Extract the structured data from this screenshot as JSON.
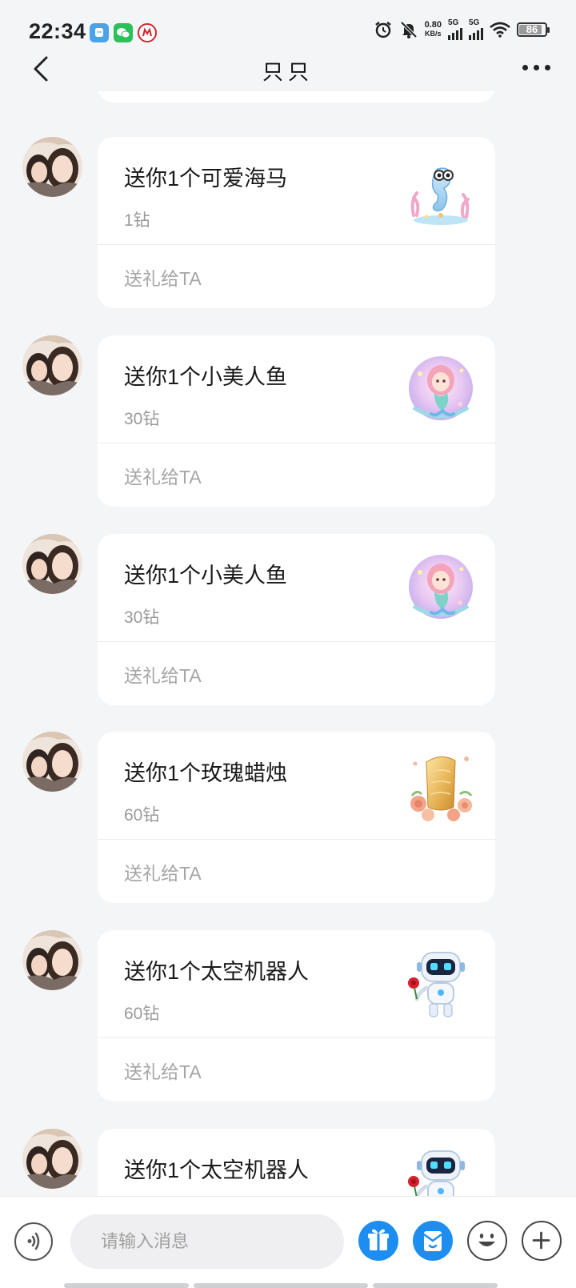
{
  "status_bar": {
    "time": "22:34",
    "net_speed_value": "0.80",
    "net_speed_unit": "KB/s",
    "sim1_label": "5G",
    "sim2_label": "5G",
    "battery": "86",
    "battery_level": 0.86,
    "app_icons": [
      "app-notification-icon",
      "wechat-icon",
      "red-app-icon"
    ]
  },
  "header": {
    "title": "只只",
    "back_icon": "chevron-left-icon",
    "more_icon": "more-dots-icon"
  },
  "messages": [
    {
      "title": "送你1个可爱海马",
      "price": "1钻",
      "action": "送礼给TA",
      "gift": "seahorse"
    },
    {
      "title": "送你1个小美人鱼",
      "price": "30钻",
      "action": "送礼给TA",
      "gift": "mermaid"
    },
    {
      "title": "送你1个小美人鱼",
      "price": "30钻",
      "action": "送礼给TA",
      "gift": "mermaid"
    },
    {
      "title": "送你1个玫瑰蜡烛",
      "price": "60钻",
      "action": "送礼给TA",
      "gift": "rose-candle"
    },
    {
      "title": "送你1个太空机器人",
      "price": "60钻",
      "action": "送礼给TA",
      "gift": "space-robot"
    },
    {
      "title": "送你1个太空机器人",
      "price": "",
      "action": "",
      "gift": "space-robot"
    }
  ],
  "input_bar": {
    "placeholder": "请输入消息",
    "buttons": [
      "voice-icon",
      "gift-icon",
      "envelope-icon",
      "emoji-icon",
      "plus-icon"
    ]
  },
  "colors": {
    "background": "#f4f5f7",
    "card": "#ffffff",
    "accent_blue": "#1d8ef0",
    "muted_text": "#9a9a9a"
  }
}
